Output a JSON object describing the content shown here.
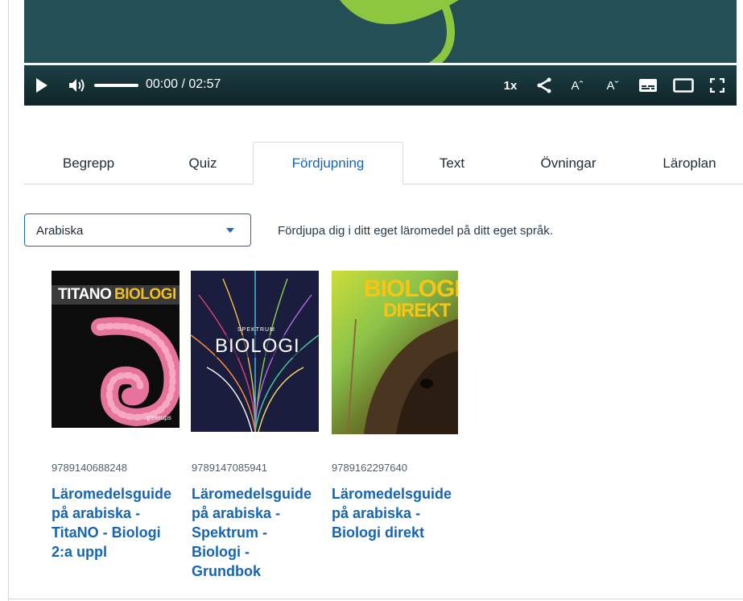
{
  "player": {
    "time": "00:00 / 02:57",
    "speed": "1x",
    "font_increase": "Aˆ",
    "font_decrease": "Aˇ",
    "icons": [
      "play-icon",
      "volume-icon",
      "share-icon",
      "captions-icon",
      "theater-mode-icon",
      "fullscreen-icon"
    ]
  },
  "tabs": [
    {
      "label": "Begrepp"
    },
    {
      "label": "Quiz"
    },
    {
      "label": "Fördjupning"
    },
    {
      "label": "Text"
    },
    {
      "label": "Övningar"
    },
    {
      "label": "Läroplan"
    }
  ],
  "language_select": {
    "value": "Arabiska"
  },
  "hint": "Fördjupa dig i ditt eget läromedel på ditt eget språk.",
  "books": [
    {
      "isbn": "9789140688248",
      "title": "Läromedelsguide på arabiska - TitaNO - Biologi 2:a uppl",
      "title_lines": [
        "Läromedelsguide",
        "på arabiska -",
        "TitaNO - Biologi",
        "2:a uppl"
      ],
      "cover_text": {
        "a": "TITANO",
        "b": "BIOLOGI",
        "publisher": "gleerups"
      }
    },
    {
      "isbn": "9789147085941",
      "title": "Läromedelsguide på arabiska - Spektrum - Biologi - Grundbok",
      "title_lines": [
        "Läromedelsguide",
        "på arabiska -",
        "Spektrum -",
        "Biologi -",
        "Grundbok"
      ],
      "cover_text": {
        "series": "SPEKTRUM",
        "main": "BIOLOGI"
      }
    },
    {
      "isbn": "9789162297640",
      "title": "Läromedelsguide på arabiska - Biologi direkt",
      "title_lines": [
        "Läromedelsguide",
        "på arabiska -",
        "Biologi direkt"
      ],
      "cover_text": {
        "a": "BIOLOGI",
        "b": "DIREKT"
      }
    }
  ],
  "colors": {
    "accent": "#1565b7",
    "player_bg": "#234f55",
    "leaf": "#8dc63f"
  }
}
